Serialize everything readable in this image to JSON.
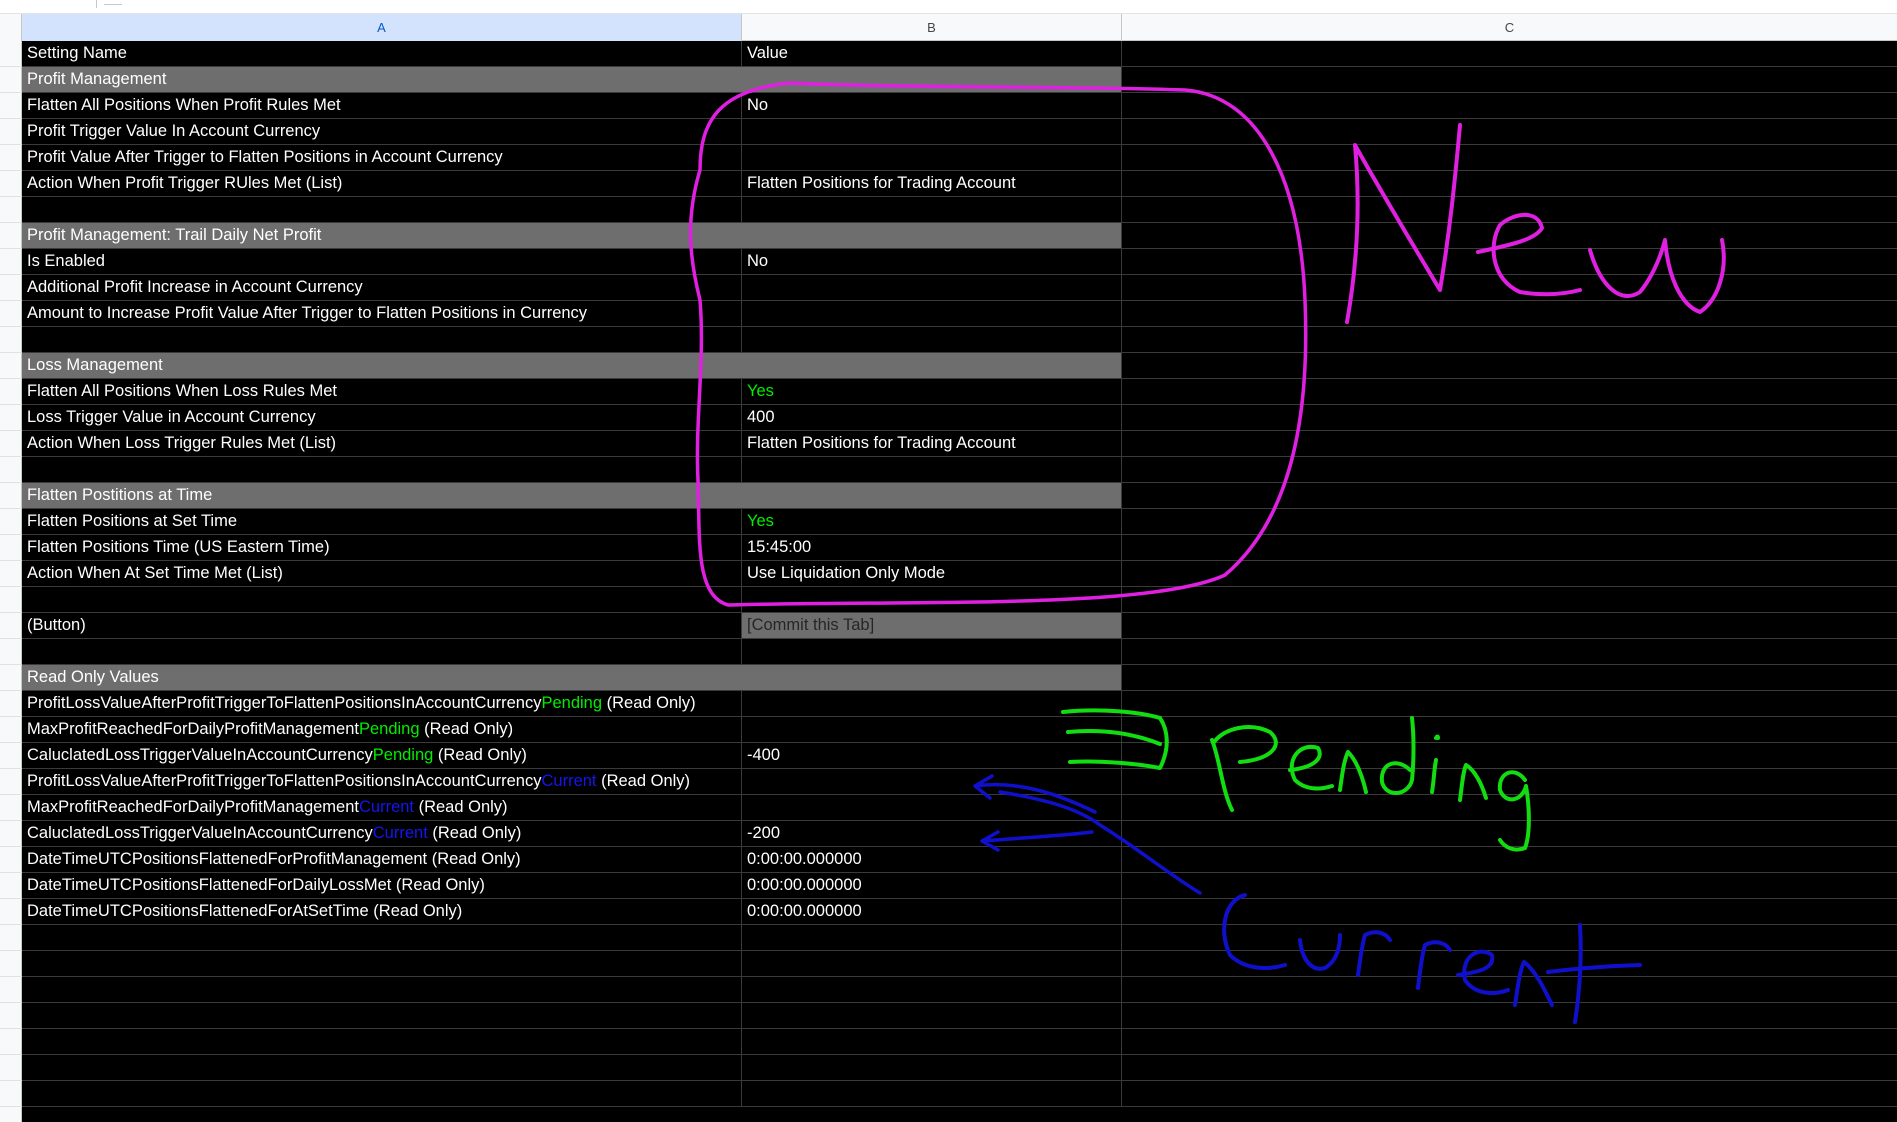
{
  "columns": [
    "A",
    "B",
    "C"
  ],
  "colors": {
    "background": "#000000",
    "section_fill": "#6e6e6e",
    "pending_text": "#00ee00",
    "current_text": "#1515ee",
    "selected_header": "#d3e3fd",
    "annotation_magenta": "#e020e0",
    "annotation_green": "#11dd11",
    "annotation_blue": "#1010cc"
  },
  "rows": {
    "header": {
      "a": "Setting Name",
      "b": "Value"
    },
    "profit_mgmt": {
      "a": "Profit Management"
    },
    "flatten_profit": {
      "a": "Flatten All Positions When Profit Rules Met",
      "b": "No"
    },
    "profit_trigger": {
      "a": "Profit Trigger Value In Account Currency"
    },
    "profit_after": {
      "a": "Profit Value After Trigger to Flatten Positions in Account Currency"
    },
    "action_profit": {
      "a": "Action When Profit Trigger RUles Met (List)",
      "b": "Flatten Positions for Trading Account"
    },
    "trail": {
      "a": "Profit Management: Trail Daily Net Profit"
    },
    "is_enabled": {
      "a": "Is Enabled",
      "b": "No"
    },
    "additional": {
      "a": "Additional Profit Increase in Account Currency"
    },
    "amount_increase": {
      "a": "Amount to Increase Profit Value After Trigger to Flatten Positions in Currency"
    },
    "loss_mgmt": {
      "a": "Loss Management"
    },
    "flatten_loss": {
      "a": "Flatten All Positions When Loss Rules Met",
      "b": "Yes"
    },
    "loss_trigger": {
      "a": "Loss Trigger Value in Account Currency",
      "b": "400"
    },
    "action_loss": {
      "a": "Action When Loss Trigger Rules Met (List)",
      "b": "Flatten Positions for Trading Account"
    },
    "flatten_time_section": {
      "a": "Flatten Postitions at Time"
    },
    "flatten_set_time": {
      "a": "Flatten Positions at Set Time",
      "b": "Yes"
    },
    "flatten_time": {
      "a": "Flatten Positions Time (US Eastern Time)",
      "b": "15:45:00"
    },
    "action_time": {
      "a": "Action When At Set Time Met (List)",
      "b": "Use Liquidation Only Mode"
    },
    "button": {
      "a": "(Button)",
      "b": "[Commit this Tab]"
    },
    "readonly": {
      "a": "Read Only Values"
    },
    "ro1": {
      "pre": "ProfitLossValueAfterProfitTriggerToFlattenPositionsInAccountCurrency",
      "tag": "Pending",
      "post": " (Read Only)"
    },
    "ro2": {
      "pre": "MaxProfitReachedForDailyProfitManagement",
      "tag": "Pending",
      "post": " (Read Only)"
    },
    "ro3": {
      "pre": "CaluclatedLossTriggerValueInAccountCurrency",
      "tag": "Pending",
      "post": " (Read Only)",
      "b": "-400"
    },
    "ro4": {
      "pre": "ProfitLossValueAfterProfitTriggerToFlattenPositionsInAccountCurrency",
      "tag": "Current",
      "post": " (Read Only)"
    },
    "ro5": {
      "pre": "MaxProfitReachedForDailyProfitManagement",
      "tag": "Current",
      "post": " (Read Only)"
    },
    "ro6": {
      "pre": "CaluclatedLossTriggerValueInAccountCurrency",
      "tag": "Current",
      "post": " (Read Only)",
      "b": "-200"
    },
    "ro7": {
      "a": "DateTimeUTCPositionsFlattenedForProfitManagement (Read Only)",
      "b": "0:00:00.000000"
    },
    "ro8": {
      "a": "DateTimeUTCPositionsFlattenedForDailyLossMet (Read Only)",
      "b": "0:00:00.000000"
    },
    "ro9": {
      "a": "DateTimeUTCPositionsFlattenedForAtSetTime (Read Only)",
      "b": "0:00:00.000000"
    }
  },
  "annotations": [
    "New",
    "Pending",
    "Current"
  ]
}
